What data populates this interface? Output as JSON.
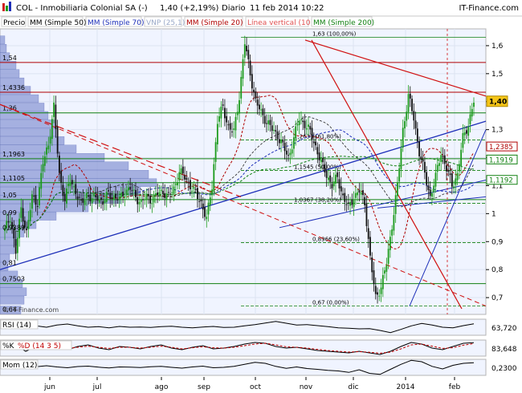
{
  "header": {
    "title": "COL - Inmobiliaria Colonial SA (-)",
    "price_change": "1,40 (+2,19%)",
    "period": "Diario",
    "datetime": "11 feb 2014 10:22",
    "brand": "IT-Finance.com"
  },
  "legend": [
    {
      "label": "Precio",
      "color": "#000000"
    },
    {
      "label": "MM (Simple 50)",
      "color": "#000000"
    },
    {
      "label": "MM (Simple 70)",
      "color": "#1d2fb8"
    },
    {
      "label": "VNP (25,1)",
      "color": "#9aa9c8"
    },
    {
      "label": "MM (Simple 20)",
      "color": "#b00000"
    },
    {
      "label": "Línea vertical (10)",
      "color": "#e05050"
    },
    {
      "label": "MM (Simple 200)",
      "color": "#108010"
    }
  ],
  "watermark": "© IT-Finance.com",
  "colors": {
    "up": "#1a9a1a",
    "down": "#111111",
    "ma50": "#222222",
    "ma70": "#1d2fb8",
    "ma20": "#b00000",
    "ma200": "#108010",
    "trend_blue": "#1d2fb8",
    "trend_red": "#d01010",
    "fib": "#108010",
    "volume_profile": "#8c9ad6",
    "price_badge": "#f5c518",
    "resistance_red": "#b00000"
  },
  "chart_data": [
    {
      "type": "candlestick",
      "name": "Precio",
      "x_ticks": [
        "jun",
        "jul",
        "ago",
        "sep",
        "oct",
        "nov",
        "dic",
        "2014",
        "feb"
      ],
      "y_ticks": [
        "0,7",
        "0,8",
        "0,9",
        "1",
        "1,1",
        "1,2",
        "1,3",
        "1,4",
        "1,5",
        "1,6"
      ],
      "ylim": [
        0.64,
        1.66
      ],
      "last_price": 1.4,
      "last_label": "1,40",
      "close_path": [
        [
          0,
          0.94
        ],
        [
          3,
          0.99
        ],
        [
          6,
          0.86
        ],
        [
          9,
          1.02
        ],
        [
          12,
          0.93
        ],
        [
          15,
          1.06
        ],
        [
          18,
          1.04
        ],
        [
          21,
          1.18
        ],
        [
          24,
          1.25
        ],
        [
          27,
          1.38
        ],
        [
          30,
          1.14
        ],
        [
          33,
          1.05
        ],
        [
          36,
          1.12
        ],
        [
          39,
          1.08
        ],
        [
          42,
          1.03
        ],
        [
          45,
          1.07
        ],
        [
          48,
          1.05
        ],
        [
          51,
          1.06
        ],
        [
          54,
          1.04
        ],
        [
          57,
          1.07
        ],
        [
          60,
          1.06
        ],
        [
          63,
          1.05
        ],
        [
          66,
          1.08
        ],
        [
          69,
          1.09
        ],
        [
          72,
          1.06
        ],
        [
          75,
          1.04
        ],
        [
          78,
          1.06
        ],
        [
          81,
          1.05
        ],
        [
          84,
          1.07
        ],
        [
          87,
          1.08
        ],
        [
          90,
          1.06
        ],
        [
          93,
          1.09
        ],
        [
          96,
          1.15
        ],
        [
          99,
          1.13
        ],
        [
          102,
          1.1
        ],
        [
          105,
          1.07
        ],
        [
          108,
          1.04
        ],
        [
          111,
          0.98
        ],
        [
          114,
          1.1
        ],
        [
          117,
          1.33
        ],
        [
          120,
          1.38
        ],
        [
          123,
          1.31
        ],
        [
          126,
          1.29
        ],
        [
          129,
          1.42
        ],
        [
          132,
          1.61
        ],
        [
          135,
          1.5
        ],
        [
          138,
          1.4
        ],
        [
          141,
          1.36
        ],
        [
          144,
          1.33
        ],
        [
          147,
          1.3
        ],
        [
          150,
          1.28
        ],
        [
          153,
          1.24
        ],
        [
          156,
          1.2
        ],
        [
          159,
          1.27
        ],
        [
          162,
          1.34
        ],
        [
          165,
          1.32
        ],
        [
          168,
          1.29
        ],
        [
          171,
          1.24
        ],
        [
          174,
          1.18
        ],
        [
          177,
          1.14
        ],
        [
          180,
          1.1
        ],
        [
          183,
          1.13
        ],
        [
          186,
          1.06
        ],
        [
          189,
          1.02
        ],
        [
          192,
          1.06
        ],
        [
          195,
          1.08
        ],
        [
          198,
          1.04
        ],
        [
          201,
          0.84
        ],
        [
          204,
          0.7
        ],
        [
          207,
          0.74
        ],
        [
          210,
          0.82
        ],
        [
          213,
          0.96
        ],
        [
          216,
          1.1
        ],
        [
          219,
          1.3
        ],
        [
          222,
          1.42
        ],
        [
          225,
          1.34
        ],
        [
          228,
          1.22
        ],
        [
          231,
          1.14
        ],
        [
          234,
          1.06
        ],
        [
          237,
          1.13
        ],
        [
          240,
          1.22
        ],
        [
          243,
          1.16
        ],
        [
          246,
          1.1
        ],
        [
          249,
          1.14
        ],
        [
          252,
          1.27
        ],
        [
          255,
          1.32
        ],
        [
          258,
          1.4
        ]
      ],
      "horizontal_levels": [
        {
          "value": 1.54,
          "label": "1,54",
          "color": "#b00000"
        },
        {
          "value": 1.4336,
          "label": "1,4336",
          "color": "#b00000"
        },
        {
          "value": 1.36,
          "label": "1,36",
          "color": "#108010"
        },
        {
          "value": 1.1963,
          "label": "1,1963",
          "color": "#108010"
        },
        {
          "value": 1.1105,
          "label": "1,1105",
          "color": "#108010"
        },
        {
          "value": 1.05,
          "label": "1,05",
          "color": "#108010"
        },
        {
          "value": 0.75,
          "label": "0,7503",
          "color": "#108010"
        }
      ],
      "left_axis_labels": [
        {
          "value": 0.99,
          "label": "0,99"
        },
        {
          "value": 0.936,
          "label": "0,9389"
        },
        {
          "value": 0.81,
          "label": "0,81"
        },
        {
          "value": 0.645,
          "label": "0,64"
        }
      ],
      "right_markers": [
        {
          "value": 1.2385,
          "label": "1,2385",
          "color": "#b00000"
        },
        {
          "value": 1.1919,
          "label": "1,1919",
          "color": "#108010"
        },
        {
          "value": 1.1192,
          "label": "1,1192",
          "color": "#108010"
        }
      ],
      "fibonacci": [
        {
          "value": 1.63,
          "label": "1,63 (100,00%)"
        },
        {
          "value": 1.2633,
          "label": "1,2633 (61,80%)"
        },
        {
          "value": 1.1545,
          "label": "1,1545 (50,00%)"
        },
        {
          "value": 1.0367,
          "label": "1,0367 (38,20%)"
        },
        {
          "value": 0.8966,
          "label": "0,8966 (23,60%)"
        },
        {
          "value": 0.67,
          "label": "0,67 (0,00%)"
        }
      ]
    },
    {
      "type": "line",
      "name": "RSI (14)",
      "last_label": "63,720",
      "values": [
        48,
        52,
        45,
        55,
        50,
        58,
        62,
        55,
        50,
        52,
        48,
        53,
        50,
        51,
        49,
        52,
        54,
        50,
        48,
        51,
        53,
        49,
        50,
        55,
        60,
        66,
        72,
        65,
        58,
        60,
        56,
        52,
        48,
        46,
        44,
        45,
        38,
        30,
        42,
        55,
        64,
        58,
        50,
        48,
        56,
        63
      ]
    },
    {
      "type": "line",
      "name": "%K",
      "series": [
        {
          "name": "%K",
          "values": [
            40,
            70,
            30,
            60,
            80,
            50,
            40,
            60,
            70,
            50,
            40,
            60,
            55,
            45,
            60,
            70,
            50,
            40,
            55,
            65,
            45,
            50,
            60,
            75,
            85,
            80,
            60,
            50,
            55,
            45,
            35,
            30,
            25,
            20,
            30,
            20,
            10,
            30,
            60,
            85,
            75,
            50,
            40,
            60,
            80,
            84
          ]
        },
        {
          "name": "%D (14 3 5)",
          "values": [
            45,
            55,
            45,
            55,
            65,
            58,
            48,
            55,
            62,
            55,
            48,
            55,
            55,
            50,
            55,
            62,
            55,
            45,
            52,
            58,
            52,
            50,
            55,
            65,
            75,
            80,
            70,
            58,
            55,
            50,
            42,
            35,
            30,
            25,
            28,
            24,
            18,
            25,
            45,
            70,
            75,
            62,
            48,
            52,
            68,
            78
          ]
        }
      ],
      "last_label": "83,648"
    },
    {
      "type": "line",
      "name": "Mom (12)",
      "last_label": "0,2300",
      "values": [
        0.02,
        0.05,
        -0.04,
        0.03,
        0.08,
        0.02,
        -0.02,
        0.04,
        0.06,
        0.01,
        -0.03,
        0.02,
        0.01,
        -0.01,
        0.03,
        0.05,
        0.0,
        -0.04,
        0.02,
        0.06,
        -0.02,
        0.0,
        0.05,
        0.15,
        0.25,
        0.2,
        0.05,
        -0.05,
        0.02,
        -0.06,
        -0.1,
        -0.15,
        -0.18,
        -0.25,
        -0.12,
        -0.3,
        -0.35,
        -0.1,
        0.15,
        0.35,
        0.28,
        0.05,
        -0.08,
        0.1,
        0.2,
        0.23
      ]
    }
  ]
}
